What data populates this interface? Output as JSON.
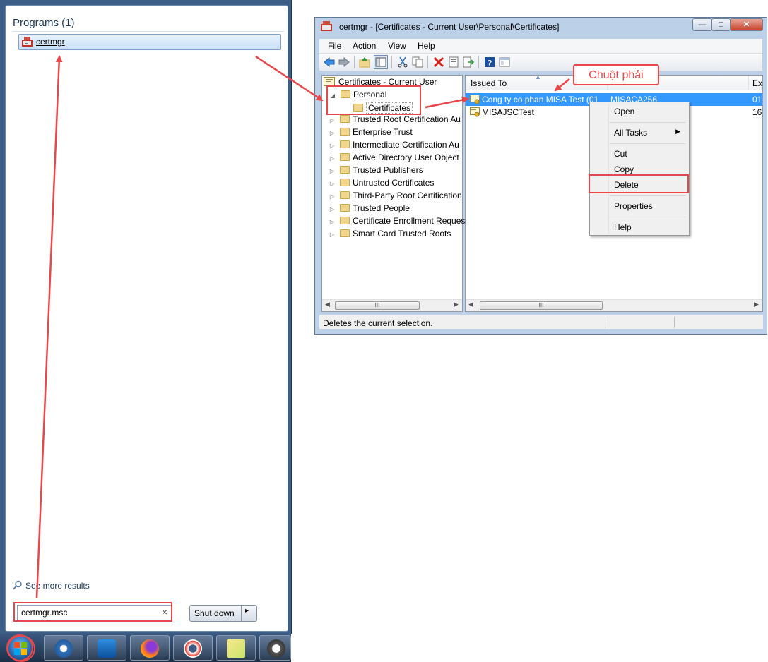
{
  "start_menu": {
    "heading": "Programs (1)",
    "result_label": "certmgr",
    "see_more": "See more results",
    "search_value": "certmgr.msc",
    "clear_glyph": "×",
    "shutdown_label": "Shut down",
    "shutdown_arrow": "▸",
    "icons": {
      "result": "certmgr-icon",
      "see_more": "search-icon"
    }
  },
  "taskbar": {
    "items": [
      "start-orb",
      "outlook-icon",
      "remote-desktop-icon",
      "firefox-icon",
      "lifebuoy-icon",
      "sticky-notes-icon",
      "teamviewer-icon"
    ]
  },
  "window": {
    "title": "certmgr - [Certificates - Current User\\Personal\\Certificates]",
    "controls": {
      "minimize": "—",
      "maximize": "□",
      "close": "✕"
    },
    "menu": [
      "File",
      "Action",
      "View",
      "Help"
    ],
    "toolbar_icons": [
      "back-icon",
      "forward-icon",
      "up-folder-icon",
      "show-hide-tree-icon",
      "cut-icon",
      "copy-icon",
      "delete-icon",
      "properties-icon",
      "export-icon",
      "help-icon",
      "view-icon"
    ],
    "tree": {
      "root": "Certificates - Current User",
      "personal": "Personal",
      "certificates": "Certificates",
      "items": [
        "Trusted Root Certification Au",
        "Enterprise Trust",
        "Intermediate Certification Au",
        "Active Directory User Object",
        "Trusted Publishers",
        "Untrusted Certificates",
        "Third-Party Root Certification",
        "Trusted People",
        "Certificate Enrollment Reques",
        "Smart Card Trusted Roots"
      ]
    },
    "list": {
      "columns": [
        "Issued To",
        "",
        "Ex"
      ],
      "rows": [
        {
          "issued_to": "Cong ty co phan MISA Test (01",
          "issued_by": "MISACA256",
          "exp": "01"
        },
        {
          "issued_to": "MISAJSCTest",
          "issued_by": "",
          "exp": "16"
        }
      ]
    },
    "scroll_thumb_label": "III",
    "status": "Deletes the current selection."
  },
  "context_menu": {
    "open": "Open",
    "all_tasks": "All Tasks",
    "submenu_arrow": "▶",
    "cut": "Cut",
    "copy": "Copy",
    "delete": "Delete",
    "properties": "Properties",
    "help": "Help"
  },
  "annotation": {
    "callout": "Chuột phải",
    "color": "#e8484b"
  }
}
